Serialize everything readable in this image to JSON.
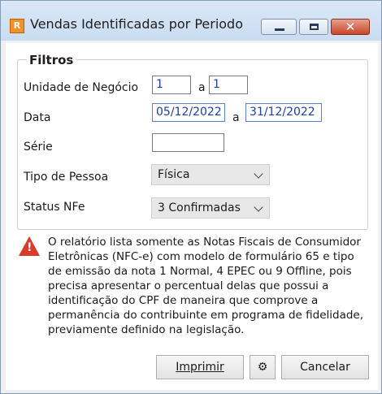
{
  "window": {
    "title": "Vendas Identificadas por Periodo",
    "app_icon_glyph": "R",
    "close_glyph": "✕"
  },
  "filters": {
    "group_title": "Filtros",
    "unidade": {
      "label": "Unidade de Negócio",
      "from": "1",
      "sep": "a",
      "to": "1"
    },
    "data": {
      "label": "Data",
      "from": "05/12/2022",
      "sep": "a",
      "to": "31/12/2022"
    },
    "serie": {
      "label": "Série",
      "value": ""
    },
    "tipo_pessoa": {
      "label": "Tipo de Pessoa",
      "value": "Física"
    },
    "status_nfe": {
      "label": "Status NFe",
      "value": "3 Confirmadas"
    }
  },
  "notice": {
    "icon": "warning-icon",
    "mark": "!",
    "text": "O relatório lista somente as Notas Fiscais de Consumidor Eletrônicas (NFC-e) com modelo de formulário 65 e tipo de emissão da nota 1 Normal, 4 EPEC ou 9 Offline, pois precisa apresentar o percentual delas que possui a identificação do CPF de maneira que comprove a permanência do contribuinte em programa de fidelidade, previamente definido na legislação."
  },
  "buttons": {
    "print": "Imprimir",
    "settings_glyph": "⚙",
    "cancel": "Cancelar"
  },
  "colors": {
    "accent_border": "#5b7fcf",
    "warning": "#d93a2b",
    "close_button": "#c9452a"
  }
}
